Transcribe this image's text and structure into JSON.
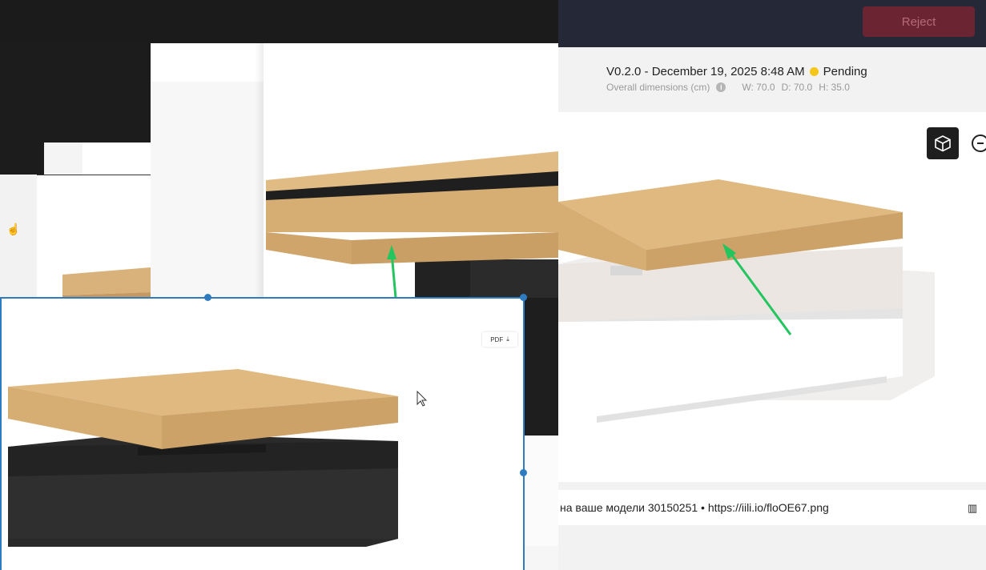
{
  "header": {
    "reject_label": "Reject"
  },
  "version": {
    "label": "V0.2.0 - December 19, 2025 8:48 AM",
    "status": "Pending",
    "status_color": "#f5c518"
  },
  "dimensions": {
    "label": "Overall dimensions (cm)",
    "width": "W: 70.0",
    "depth": "D: 70.0",
    "height": "H: 35.0"
  },
  "viewer": {
    "cube_icon": "cube-icon",
    "zoom_icon": "zoom-out-icon"
  },
  "comment": {
    "text": "на ваше модели 30150251 • https://iili.io/floOE67.png",
    "icon": "building-icon"
  },
  "left_pane": {
    "pdf_label": "PDF"
  },
  "colors": {
    "accent_green": "#22c55e",
    "selection_blue": "#2f7bbf",
    "reject_bg": "#6b2432",
    "topbar": "#252837"
  }
}
